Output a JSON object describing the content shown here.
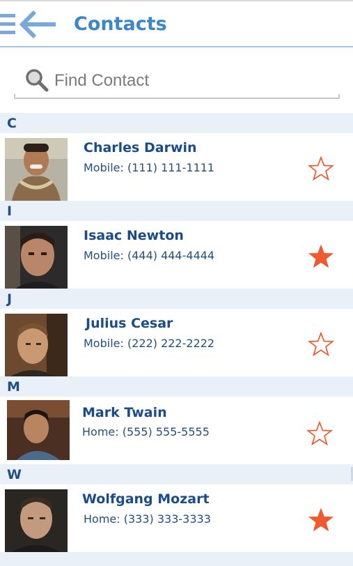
{
  "app_bar": {
    "title": "Contacts",
    "menu_icon": "hamburger-menu-icon",
    "back_icon": "back-arrow-icon",
    "accent_color": "#3a87c9"
  },
  "search": {
    "placeholder": "Find Contact",
    "value": "",
    "icon": "search-icon"
  },
  "sections": [
    {
      "letter": "C",
      "contacts": [
        {
          "name": "Charles Darwin",
          "phone_label": "Mobile:",
          "phone": "(111) 111-1111",
          "phone_text": "Mobile: (111) 111-1111",
          "favorite": false
        }
      ]
    },
    {
      "letter": "I",
      "contacts": [
        {
          "name": "Isaac Newton",
          "phone_label": "Mobile:",
          "phone": "(444) 444-4444",
          "phone_text": "Mobile: (444) 444-4444",
          "favorite": true
        }
      ]
    },
    {
      "letter": "J",
      "contacts": [
        {
          "name": "Julius Cesar",
          "phone_label": "Mobile:",
          "phone": "(222) 222-2222",
          "phone_text": "Mobile: (222) 222-2222",
          "favorite": false
        }
      ]
    },
    {
      "letter": "M",
      "contacts": [
        {
          "name": "Mark Twain",
          "phone_label": "Home:",
          "phone": "(555) 555-5555",
          "phone_text": "Home: (555) 555-5555",
          "favorite": false
        }
      ]
    },
    {
      "letter": "W",
      "contacts": [
        {
          "name": "Wolfgang Mozart",
          "phone_label": "Home:",
          "phone": "(333) 333-3333",
          "phone_text": "Home: (333) 333-3333",
          "favorite": true
        }
      ]
    }
  ],
  "colors": {
    "section_bg": "#eaf0f8",
    "name_text": "#1a4d87",
    "star": "#ef5a2e"
  }
}
